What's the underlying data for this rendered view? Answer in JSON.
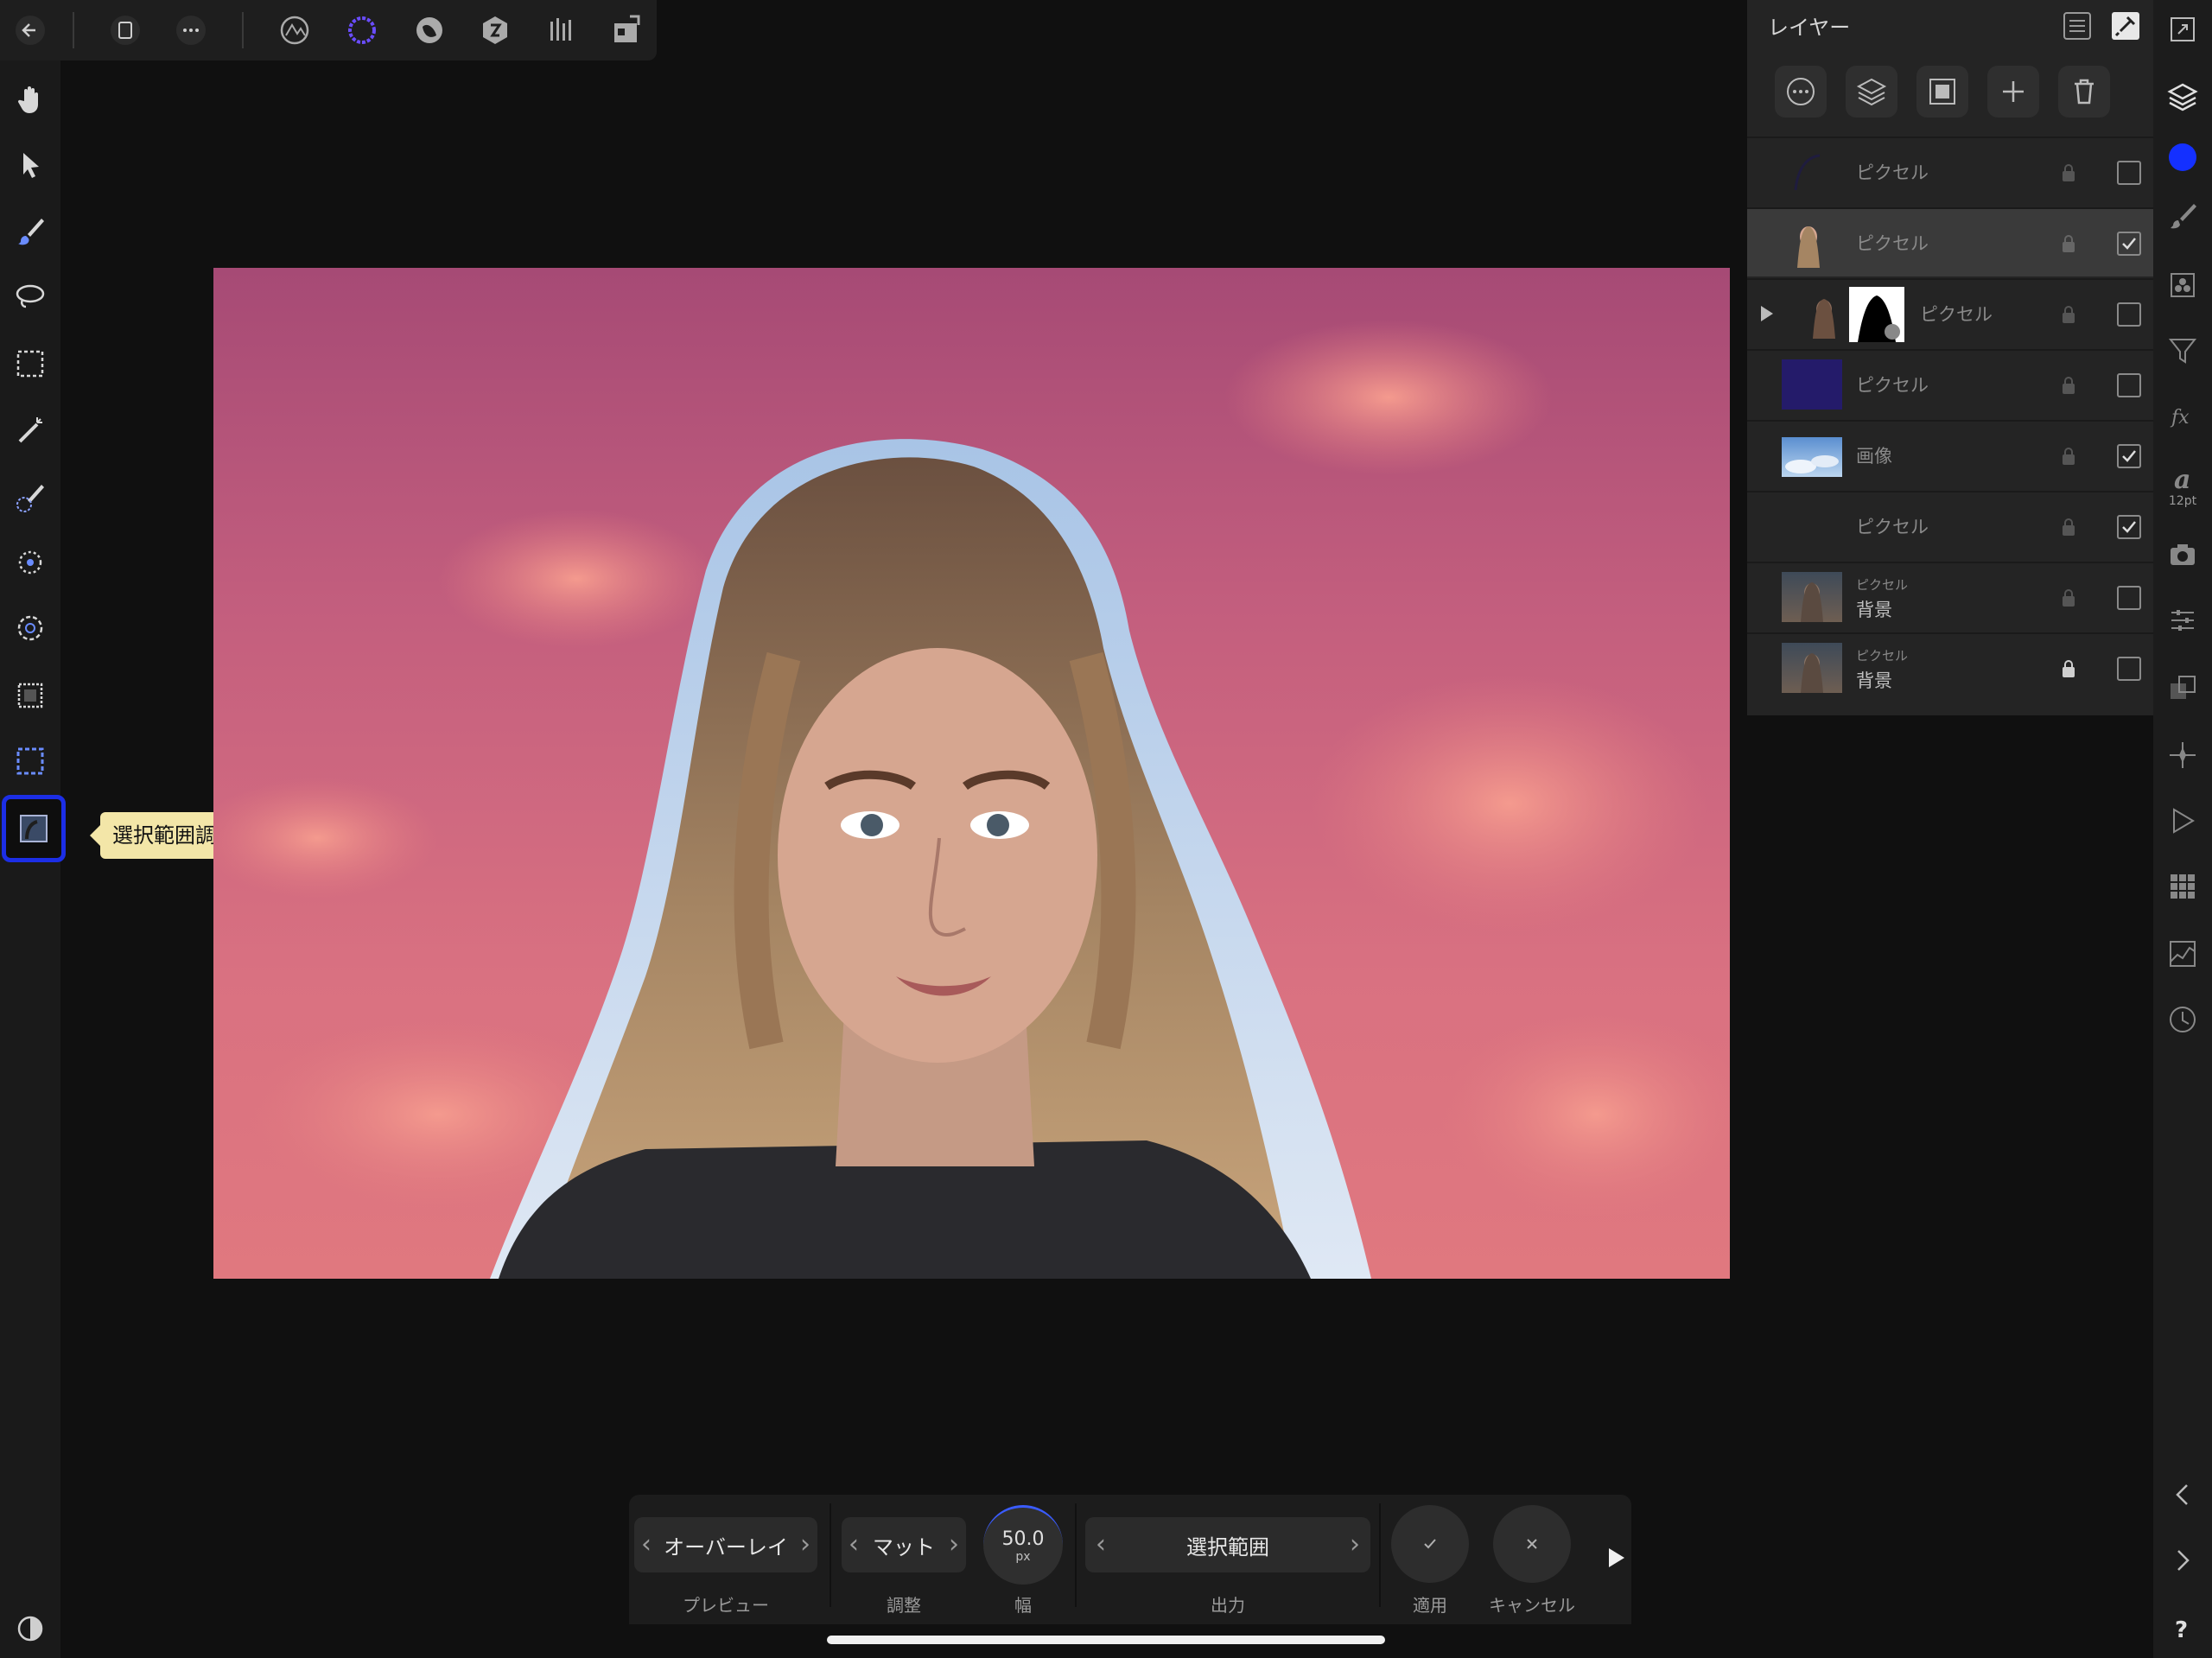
{
  "colors": {
    "accent": "#1c2ee6",
    "panel": "#242424",
    "background": "#101010",
    "tooltip": "#f3e6a8",
    "color_swatch": "#1430ff"
  },
  "top_toolbar": {
    "icons": [
      "back-arrow-icon",
      "document-icon",
      "more-icon",
      "photo-persona-icon",
      "selection-persona-icon",
      "liquify-persona-icon",
      "develop-persona-icon",
      "tone-mapping-persona-icon",
      "export-persona-icon"
    ]
  },
  "tools": {
    "icons": [
      "hand-icon",
      "move-icon",
      "paintbrush-icon",
      "lasso-icon",
      "marquee-icon",
      "magic-wand-icon",
      "selection-brush-icon",
      "flood-select-icon",
      "freehand-select-icon",
      "rect-select-icon",
      "ellipse-select-icon",
      "refine-selection-icon"
    ],
    "active_tooltip": "選択範囲調整ツール"
  },
  "layers_panel": {
    "title": "レイヤー",
    "rows": [
      {
        "name": "ピクセル",
        "checked": false,
        "selected": false
      },
      {
        "name": "ピクセル",
        "checked": true,
        "selected": true
      },
      {
        "name": "ピクセル",
        "checked": false,
        "selected": false
      },
      {
        "name": "ピクセル",
        "checked": false,
        "selected": false
      },
      {
        "name": "画像",
        "checked": true,
        "selected": false
      },
      {
        "name": "ピクセル",
        "checked": true,
        "selected": false
      },
      {
        "sub": "ピクセル",
        "name": "背景",
        "checked": false,
        "selected": false
      },
      {
        "sub": "ピクセル",
        "name": "背景",
        "checked": false,
        "selected": false
      }
    ]
  },
  "studio": {
    "text_size_label": "12pt"
  },
  "context_toolbar": {
    "preview_value": "オーバーレイ",
    "preview_label": "プレビュー",
    "adjust_value": "マット",
    "adjust_label": "調整",
    "width_value": "50.0",
    "width_unit": "px",
    "width_label": "幅",
    "output_value": "選択範囲",
    "output_label": "出力",
    "apply_label": "適用",
    "cancel_label": "キャンセル"
  }
}
